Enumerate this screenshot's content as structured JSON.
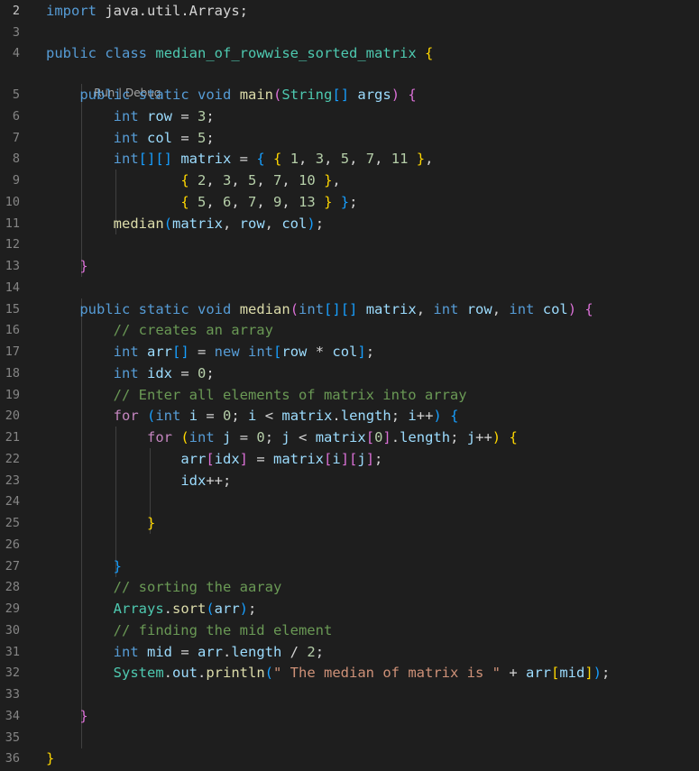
{
  "editor": {
    "language": "java",
    "codelens": {
      "run": "Run",
      "separator": " | ",
      "debug": "Debug"
    },
    "lines": [
      {
        "num": "2",
        "tokens": [
          [
            "kw",
            "import"
          ],
          [
            "op",
            " "
          ],
          [
            "op",
            "java.util.Arrays;"
          ]
        ]
      },
      {
        "num": "3",
        "tokens": []
      },
      {
        "num": "4",
        "tokens": [
          [
            "kw",
            "public"
          ],
          [
            "op",
            " "
          ],
          [
            "kw",
            "class"
          ],
          [
            "op",
            " "
          ],
          [
            "ty",
            "median_of_rowwise_sorted_matrix"
          ],
          [
            "op",
            " "
          ],
          [
            "b1",
            "{"
          ]
        ]
      },
      {
        "num": "5",
        "tokens": [
          [
            "op",
            "    "
          ],
          [
            "kw",
            "public"
          ],
          [
            "op",
            " "
          ],
          [
            "kw",
            "static"
          ],
          [
            "op",
            " "
          ],
          [
            "kw",
            "void"
          ],
          [
            "op",
            " "
          ],
          [
            "fn",
            "main"
          ],
          [
            "b2",
            "("
          ],
          [
            "ty",
            "String"
          ],
          [
            "b3",
            "[]"
          ],
          [
            "op",
            " "
          ],
          [
            "var",
            "args"
          ],
          [
            "b2",
            ")"
          ],
          [
            "op",
            " "
          ],
          [
            "b2",
            "{"
          ]
        ]
      },
      {
        "num": "6",
        "tokens": [
          [
            "op",
            "        "
          ],
          [
            "kw",
            "int"
          ],
          [
            "op",
            " "
          ],
          [
            "var",
            "row"
          ],
          [
            "op",
            " = "
          ],
          [
            "num",
            "3"
          ],
          [
            "op",
            ";"
          ]
        ]
      },
      {
        "num": "7",
        "tokens": [
          [
            "op",
            "        "
          ],
          [
            "kw",
            "int"
          ],
          [
            "op",
            " "
          ],
          [
            "var",
            "col"
          ],
          [
            "op",
            " = "
          ],
          [
            "num",
            "5"
          ],
          [
            "op",
            ";"
          ]
        ]
      },
      {
        "num": "8",
        "tokens": [
          [
            "op",
            "        "
          ],
          [
            "kw",
            "int"
          ],
          [
            "b3",
            "[][]"
          ],
          [
            "op",
            " "
          ],
          [
            "var",
            "matrix"
          ],
          [
            "op",
            " = "
          ],
          [
            "b3",
            "{"
          ],
          [
            "op",
            " "
          ],
          [
            "b1",
            "{"
          ],
          [
            "op",
            " "
          ],
          [
            "num",
            "1"
          ],
          [
            "op",
            ", "
          ],
          [
            "num",
            "3"
          ],
          [
            "op",
            ", "
          ],
          [
            "num",
            "5"
          ],
          [
            "op",
            ", "
          ],
          [
            "num",
            "7"
          ],
          [
            "op",
            ", "
          ],
          [
            "num",
            "11"
          ],
          [
            "op",
            " "
          ],
          [
            "b1",
            "}"
          ],
          [
            "op",
            ","
          ]
        ]
      },
      {
        "num": "9",
        "tokens": [
          [
            "op",
            "                "
          ],
          [
            "b1",
            "{"
          ],
          [
            "op",
            " "
          ],
          [
            "num",
            "2"
          ],
          [
            "op",
            ", "
          ],
          [
            "num",
            "3"
          ],
          [
            "op",
            ", "
          ],
          [
            "num",
            "5"
          ],
          [
            "op",
            ", "
          ],
          [
            "num",
            "7"
          ],
          [
            "op",
            ", "
          ],
          [
            "num",
            "10"
          ],
          [
            "op",
            " "
          ],
          [
            "b1",
            "}"
          ],
          [
            "op",
            ","
          ]
        ]
      },
      {
        "num": "10",
        "tokens": [
          [
            "op",
            "                "
          ],
          [
            "b1",
            "{"
          ],
          [
            "op",
            " "
          ],
          [
            "num",
            "5"
          ],
          [
            "op",
            ", "
          ],
          [
            "num",
            "6"
          ],
          [
            "op",
            ", "
          ],
          [
            "num",
            "7"
          ],
          [
            "op",
            ", "
          ],
          [
            "num",
            "9"
          ],
          [
            "op",
            ", "
          ],
          [
            "num",
            "13"
          ],
          [
            "op",
            " "
          ],
          [
            "b1",
            "}"
          ],
          [
            "op",
            " "
          ],
          [
            "b3",
            "}"
          ],
          [
            "op",
            ";"
          ]
        ]
      },
      {
        "num": "11",
        "tokens": [
          [
            "op",
            "        "
          ],
          [
            "fn",
            "median"
          ],
          [
            "b3",
            "("
          ],
          [
            "var",
            "matrix"
          ],
          [
            "op",
            ", "
          ],
          [
            "var",
            "row"
          ],
          [
            "op",
            ", "
          ],
          [
            "var",
            "col"
          ],
          [
            "b3",
            ")"
          ],
          [
            "op",
            ";"
          ]
        ]
      },
      {
        "num": "12",
        "tokens": []
      },
      {
        "num": "13",
        "tokens": [
          [
            "op",
            "    "
          ],
          [
            "b2",
            "}"
          ]
        ]
      },
      {
        "num": "14",
        "tokens": []
      },
      {
        "num": "15",
        "tokens": [
          [
            "op",
            "    "
          ],
          [
            "kw",
            "public"
          ],
          [
            "op",
            " "
          ],
          [
            "kw",
            "static"
          ],
          [
            "op",
            " "
          ],
          [
            "kw",
            "void"
          ],
          [
            "op",
            " "
          ],
          [
            "fn",
            "median"
          ],
          [
            "b2",
            "("
          ],
          [
            "kw",
            "int"
          ],
          [
            "b3",
            "[][]"
          ],
          [
            "op",
            " "
          ],
          [
            "var",
            "matrix"
          ],
          [
            "op",
            ", "
          ],
          [
            "kw",
            "int"
          ],
          [
            "op",
            " "
          ],
          [
            "var",
            "row"
          ],
          [
            "op",
            ", "
          ],
          [
            "kw",
            "int"
          ],
          [
            "op",
            " "
          ],
          [
            "var",
            "col"
          ],
          [
            "b2",
            ")"
          ],
          [
            "op",
            " "
          ],
          [
            "b2",
            "{"
          ]
        ]
      },
      {
        "num": "16",
        "tokens": [
          [
            "op",
            "        "
          ],
          [
            "com",
            "// creates an array"
          ]
        ]
      },
      {
        "num": "17",
        "tokens": [
          [
            "op",
            "        "
          ],
          [
            "kw",
            "int"
          ],
          [
            "op",
            " "
          ],
          [
            "var",
            "arr"
          ],
          [
            "b3",
            "[]"
          ],
          [
            "op",
            " = "
          ],
          [
            "kw",
            "new"
          ],
          [
            "op",
            " "
          ],
          [
            "kw",
            "int"
          ],
          [
            "b3",
            "["
          ],
          [
            "var",
            "row"
          ],
          [
            "op",
            " * "
          ],
          [
            "var",
            "col"
          ],
          [
            "b3",
            "]"
          ],
          [
            "op",
            ";"
          ]
        ]
      },
      {
        "num": "18",
        "tokens": [
          [
            "op",
            "        "
          ],
          [
            "kw",
            "int"
          ],
          [
            "op",
            " "
          ],
          [
            "var",
            "idx"
          ],
          [
            "op",
            " = "
          ],
          [
            "num",
            "0"
          ],
          [
            "op",
            ";"
          ]
        ]
      },
      {
        "num": "19",
        "tokens": [
          [
            "op",
            "        "
          ],
          [
            "com",
            "// Enter all elements of matrix into array"
          ]
        ]
      },
      {
        "num": "20",
        "tokens": [
          [
            "op",
            "        "
          ],
          [
            "ctl",
            "for"
          ],
          [
            "op",
            " "
          ],
          [
            "b3",
            "("
          ],
          [
            "kw",
            "int"
          ],
          [
            "op",
            " "
          ],
          [
            "var",
            "i"
          ],
          [
            "op",
            " = "
          ],
          [
            "num",
            "0"
          ],
          [
            "op",
            "; "
          ],
          [
            "var",
            "i"
          ],
          [
            "op",
            " < "
          ],
          [
            "var",
            "matrix"
          ],
          [
            "op",
            "."
          ],
          [
            "var",
            "length"
          ],
          [
            "op",
            "; "
          ],
          [
            "var",
            "i"
          ],
          [
            "op",
            "++"
          ],
          [
            "b3",
            ")"
          ],
          [
            "op",
            " "
          ],
          [
            "b3",
            "{"
          ]
        ]
      },
      {
        "num": "21",
        "tokens": [
          [
            "op",
            "            "
          ],
          [
            "ctl",
            "for"
          ],
          [
            "op",
            " "
          ],
          [
            "b1",
            "("
          ],
          [
            "kw",
            "int"
          ],
          [
            "op",
            " "
          ],
          [
            "var",
            "j"
          ],
          [
            "op",
            " = "
          ],
          [
            "num",
            "0"
          ],
          [
            "op",
            "; "
          ],
          [
            "var",
            "j"
          ],
          [
            "op",
            " < "
          ],
          [
            "var",
            "matrix"
          ],
          [
            "b2",
            "["
          ],
          [
            "num",
            "0"
          ],
          [
            "b2",
            "]"
          ],
          [
            "op",
            "."
          ],
          [
            "var",
            "length"
          ],
          [
            "op",
            "; "
          ],
          [
            "var",
            "j"
          ],
          [
            "op",
            "++"
          ],
          [
            "b1",
            ")"
          ],
          [
            "op",
            " "
          ],
          [
            "b1",
            "{"
          ]
        ]
      },
      {
        "num": "22",
        "tokens": [
          [
            "op",
            "                "
          ],
          [
            "var",
            "arr"
          ],
          [
            "b2",
            "["
          ],
          [
            "var",
            "idx"
          ],
          [
            "b2",
            "]"
          ],
          [
            "op",
            " = "
          ],
          [
            "var",
            "matrix"
          ],
          [
            "b2",
            "["
          ],
          [
            "var",
            "i"
          ],
          [
            "b2",
            "]["
          ],
          [
            "var",
            "j"
          ],
          [
            "b2",
            "]"
          ],
          [
            "op",
            ";"
          ]
        ]
      },
      {
        "num": "23",
        "tokens": [
          [
            "op",
            "                "
          ],
          [
            "var",
            "idx"
          ],
          [
            "op",
            "++;"
          ]
        ]
      },
      {
        "num": "24",
        "tokens": []
      },
      {
        "num": "25",
        "tokens": [
          [
            "op",
            "            "
          ],
          [
            "b1",
            "}"
          ]
        ]
      },
      {
        "num": "26",
        "tokens": []
      },
      {
        "num": "27",
        "tokens": [
          [
            "op",
            "        "
          ],
          [
            "b3",
            "}"
          ]
        ]
      },
      {
        "num": "28",
        "tokens": [
          [
            "op",
            "        "
          ],
          [
            "com",
            "// sorting the aaray"
          ]
        ]
      },
      {
        "num": "29",
        "tokens": [
          [
            "op",
            "        "
          ],
          [
            "ty",
            "Arrays"
          ],
          [
            "op",
            "."
          ],
          [
            "fn",
            "sort"
          ],
          [
            "b3",
            "("
          ],
          [
            "var",
            "arr"
          ],
          [
            "b3",
            ")"
          ],
          [
            "op",
            ";"
          ]
        ]
      },
      {
        "num": "30",
        "tokens": [
          [
            "op",
            "        "
          ],
          [
            "com",
            "// finding the mid element"
          ]
        ]
      },
      {
        "num": "31",
        "tokens": [
          [
            "op",
            "        "
          ],
          [
            "kw",
            "int"
          ],
          [
            "op",
            " "
          ],
          [
            "var",
            "mid"
          ],
          [
            "op",
            " = "
          ],
          [
            "var",
            "arr"
          ],
          [
            "op",
            "."
          ],
          [
            "var",
            "length"
          ],
          [
            "op",
            " / "
          ],
          [
            "num",
            "2"
          ],
          [
            "op",
            ";"
          ]
        ]
      },
      {
        "num": "32",
        "tokens": [
          [
            "op",
            "        "
          ],
          [
            "ty",
            "System"
          ],
          [
            "op",
            "."
          ],
          [
            "var",
            "out"
          ],
          [
            "op",
            "."
          ],
          [
            "fn",
            "println"
          ],
          [
            "b3",
            "("
          ],
          [
            "str",
            "\" The median of matrix is \""
          ],
          [
            "op",
            " + "
          ],
          [
            "var",
            "arr"
          ],
          [
            "b1",
            "["
          ],
          [
            "var",
            "mid"
          ],
          [
            "b1",
            "]"
          ],
          [
            "b3",
            ")"
          ],
          [
            "op",
            ";"
          ]
        ]
      },
      {
        "num": "33",
        "tokens": []
      },
      {
        "num": "34",
        "tokens": [
          [
            "op",
            "    "
          ],
          [
            "b2",
            "}"
          ]
        ]
      },
      {
        "num": "35",
        "tokens": []
      },
      {
        "num": "36",
        "tokens": [
          [
            "b1",
            "}"
          ]
        ]
      }
    ]
  }
}
